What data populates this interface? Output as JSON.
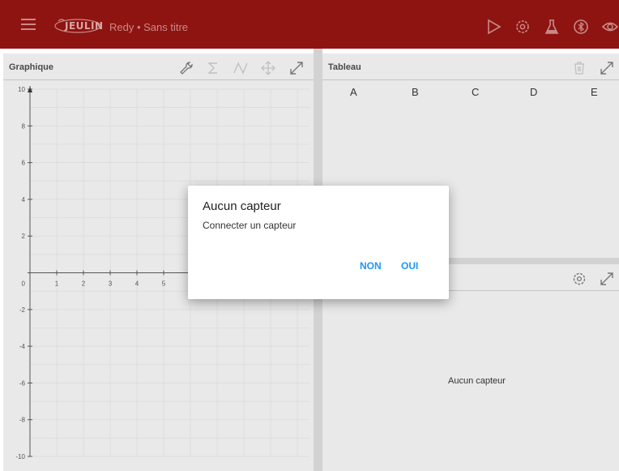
{
  "appbar": {
    "logo_text": "JEULIN",
    "title": "Redy • Sans titre",
    "icons": [
      "menu-icon",
      "play-icon",
      "settings-icon",
      "flask-icon",
      "bluetooth-icon",
      "eye-icon"
    ]
  },
  "graph_panel": {
    "title": "Graphique",
    "tools": [
      "wrench-icon",
      "sigma-icon",
      "curve-icon",
      "move-icon",
      "expand-icon"
    ],
    "y_ticks": [
      "10",
      "8",
      "6",
      "4",
      "2",
      "0",
      "-2",
      "-4",
      "-6",
      "-8",
      "-10"
    ],
    "x_ticks": [
      "1",
      "2",
      "3",
      "4",
      "5"
    ]
  },
  "table_panel": {
    "title": "Tableau",
    "columns": [
      "A",
      "B",
      "C",
      "D",
      "E"
    ],
    "tools": [
      "trash-icon",
      "expand-icon"
    ]
  },
  "sensor_panel": {
    "empty_text": "Aucun capteur",
    "tools": [
      "settings-icon",
      "expand-icon"
    ]
  },
  "dialog": {
    "title": "Aucun capteur",
    "message": "Connecter un capteur",
    "no_label": "NON",
    "yes_label": "OUI"
  },
  "colors": {
    "appbar": "#8e1411",
    "panel": "#e9e9e9",
    "accent": "#2196f3"
  }
}
